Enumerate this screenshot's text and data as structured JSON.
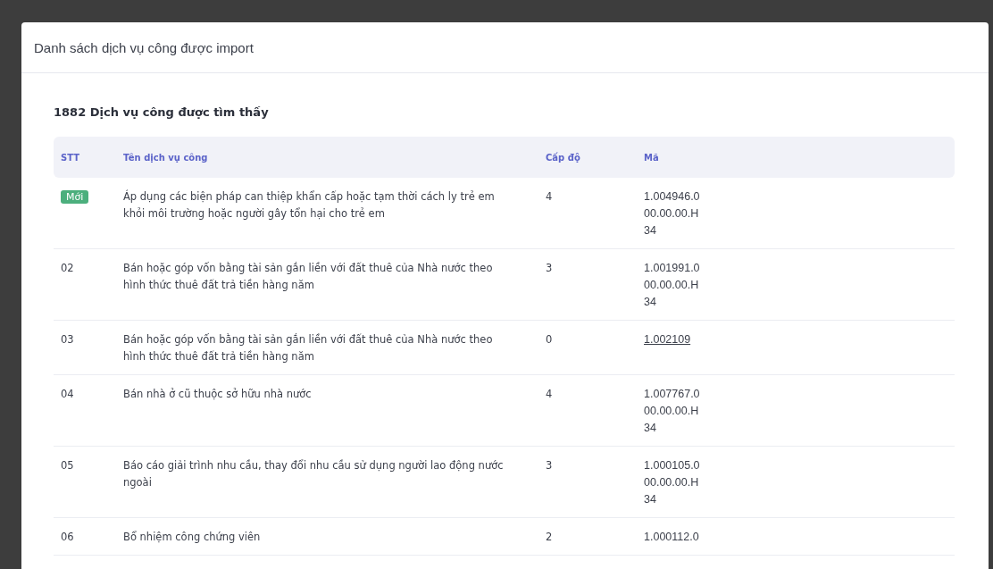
{
  "dialog": {
    "title": "Danh sách dịch vụ công được import"
  },
  "result_heading": "1882 Dịch vụ công được tìm thấy",
  "table": {
    "columns": [
      "STT",
      "Tên dịch vụ công",
      "Cấp độ",
      "Mã"
    ],
    "rows": [
      {
        "stt": "Mới",
        "badge": true,
        "name": "Áp dụng các biện pháp can thiệp khẩn cấp hoặc tạm thời cách ly trẻ em khỏi môi trường hoặc người gây tổn hại cho trẻ em",
        "level": "4",
        "code": "1.004946.000.00.00.H34",
        "underlined": false
      },
      {
        "stt": "02",
        "badge": false,
        "name": "Bán hoặc góp vốn bằng tài sản gắn liền với đất thuê của Nhà nước theo hình thức thuê đất trả tiền hàng năm",
        "level": "3",
        "code": "1.001991.000.00.00.H34",
        "underlined": false
      },
      {
        "stt": "03",
        "badge": false,
        "name": "Bán hoặc góp vốn bằng tài sản gắn liền với đất thuê của Nhà nước theo hình thức thuê đất trả tiền hàng năm",
        "level": "0",
        "code": "1.002109",
        "underlined": true
      },
      {
        "stt": "04",
        "badge": false,
        "name": "Bán nhà ở cũ thuộc sở hữu nhà nước",
        "level": "4",
        "code": "1.007767.000.00.00.H34",
        "underlined": false
      },
      {
        "stt": "05",
        "badge": false,
        "name": "Báo cáo giải trình nhu cầu, thay đổi nhu cầu sử dụng người lao động nước ngoài",
        "level": "3",
        "code": "1.000105.000.00.00.H34",
        "underlined": false
      },
      {
        "stt": "06",
        "badge": false,
        "name": "Bổ nhiệm công chứng viên",
        "level": "2",
        "code": "1.000112.0",
        "underlined": false
      }
    ]
  }
}
